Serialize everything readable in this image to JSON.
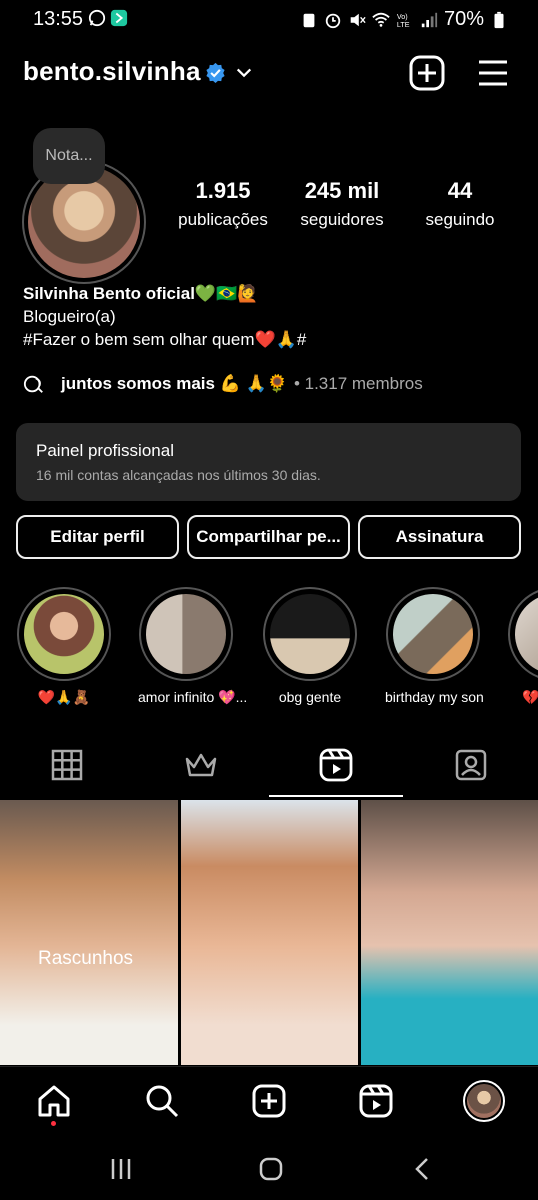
{
  "status_bar": {
    "time": "13:55",
    "battery": "70%",
    "left_icons": [
      "whatsapp-icon",
      "app-icon"
    ],
    "right_icons": [
      "lock-icon",
      "alarm-icon",
      "mute-icon",
      "wifi-icon",
      "volte-icon",
      "signal-icon",
      "battery-icon"
    ]
  },
  "header": {
    "username": "bento.silvinha",
    "verified": true
  },
  "profile": {
    "note": "Nota...",
    "stats": [
      {
        "value": "1.915",
        "label": "publicações"
      },
      {
        "value": "245 mil",
        "label": "seguidores"
      },
      {
        "value": "44",
        "label": "seguindo"
      }
    ],
    "name": "Silvinha Bento oficial💚🇧🇷🙋",
    "category": "Blogueiro(a)",
    "bio": "#Fazer o bem sem olhar quem❤️🙏#",
    "community": {
      "name": "juntos somos mais 💪 🙏🌻",
      "members": "• 1.317 membros"
    }
  },
  "professional_panel": {
    "title": "Painel profissional",
    "subtitle": "16 mil contas alcançadas nos últimos 30 dias."
  },
  "buttons": {
    "edit": "Editar perfil",
    "share": "Compartilhar pe...",
    "subscribe": "Assinatura"
  },
  "highlights": [
    {
      "label": "❤️🙏🧸"
    },
    {
      "label": "amor infinito 💖..."
    },
    {
      "label": "obg gente"
    },
    {
      "label": "birthday my son"
    },
    {
      "label": "💔"
    }
  ],
  "tabs": [
    "grid-icon",
    "crown-icon",
    "reels-icon",
    "tagged-icon"
  ],
  "grid": {
    "draft_label": "Rascunhos"
  },
  "accent_colors": {
    "verified": "#3897f0",
    "notification_dot": "#ff3040",
    "panel_bg": "#262626"
  }
}
